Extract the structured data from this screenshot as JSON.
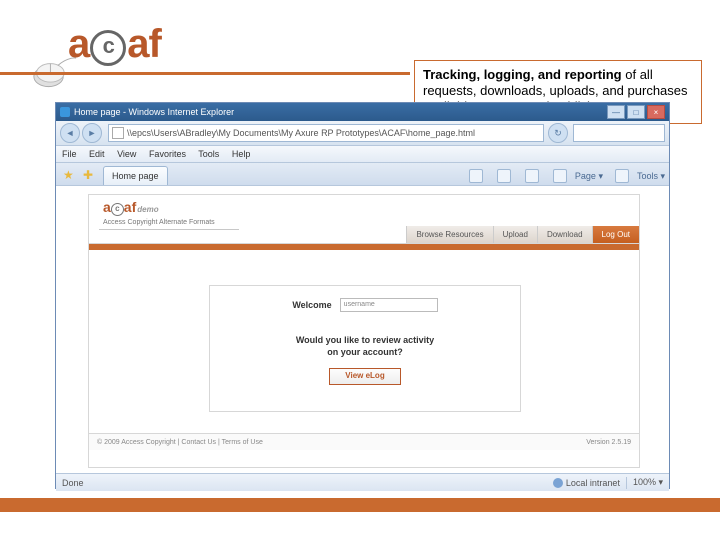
{
  "slide_logo": {
    "a": "a",
    "c": "c",
    "af": "af"
  },
  "annotation": {
    "title": "Tracking, logging, and reporting",
    "body": "of all requests, downloads, uploads, and purchases available to users and publishers."
  },
  "browser": {
    "title": "Home page - Windows Internet Explorer",
    "win": {
      "min": "—",
      "max": "□",
      "close": "×"
    },
    "nav": {
      "back": "◄",
      "fwd": "►"
    },
    "address": "\\\\epcs\\Users\\ABradley\\My Documents\\My Axure RP Prototypes\\ACAF\\home_page.html",
    "menu": {
      "file": "File",
      "edit": "Edit",
      "view": "View",
      "favorites": "Favorites",
      "tools": "Tools",
      "help": "Help"
    },
    "tab": "Home page",
    "toolbar": {
      "home": "",
      "print": "",
      "page": "Page ▾",
      "tools": "Tools ▾"
    },
    "status": {
      "left": "Done",
      "zone": "Local intranet",
      "zoom": "100%  ▾"
    }
  },
  "page": {
    "logo": {
      "a": "a",
      "c": "c",
      "af": "af",
      "demo": "demo"
    },
    "subtitle": "Access Copyright Alternate Formats",
    "nav": {
      "browse": "Browse Resources",
      "upload": "Upload",
      "download": "Download",
      "logout": "Log Out"
    },
    "form": {
      "welcome": "Welcome",
      "username": "username",
      "question_l1": "Would you like to review activity",
      "question_l2": "on your account?",
      "button": "View eLog"
    },
    "footer": {
      "left": "© 2009 Access Copyright | Contact Us | Terms of Use",
      "version": "Version 2.5.19"
    }
  }
}
